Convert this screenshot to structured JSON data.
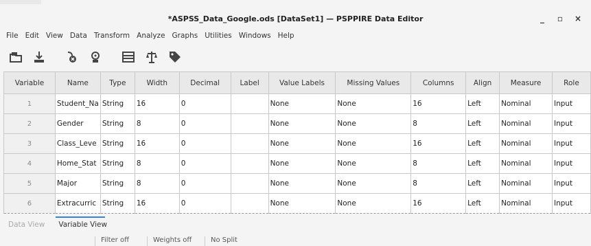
{
  "window": {
    "title": "*ASPSS_Data_Google.ods [DataSet1] — PSPPIRE Data Editor",
    "controls": [
      "_",
      "▫",
      "×"
    ]
  },
  "menu": [
    "File",
    "Edit",
    "View",
    "Data",
    "Transform",
    "Analyze",
    "Graphs",
    "Utilities",
    "Windows",
    "Help"
  ],
  "toolbar": [
    "open-icon",
    "save-icon",
    "goto-case-icon",
    "goto-variable-icon",
    "split-file-icon",
    "weight-cases-icon",
    "value-labels-icon"
  ],
  "grid": {
    "columns": [
      "Variable",
      "Name",
      "Type",
      "Width",
      "Decimal",
      "Label",
      "Value Labels",
      "Missing Values",
      "Columns",
      "Align",
      "Measure",
      "Role"
    ],
    "rows": [
      [
        "1",
        "Student_Na",
        "String",
        "16",
        "0",
        "",
        "None",
        "None",
        "16",
        "Left",
        "Nominal",
        "Input"
      ],
      [
        "2",
        "Gender",
        "String",
        "8",
        "0",
        "",
        "None",
        "None",
        "8",
        "Left",
        "Nominal",
        "Input"
      ],
      [
        "3",
        "Class_Leve",
        "String",
        "16",
        "0",
        "",
        "None",
        "None",
        "16",
        "Left",
        "Nominal",
        "Input"
      ],
      [
        "4",
        "Home_Stat",
        "String",
        "8",
        "0",
        "",
        "None",
        "None",
        "8",
        "Left",
        "Nominal",
        "Input"
      ],
      [
        "5",
        "Major",
        "String",
        "8",
        "0",
        "",
        "None",
        "None",
        "8",
        "Left",
        "Nominal",
        "Input"
      ],
      [
        "6",
        "Extracurric",
        "String",
        "16",
        "0",
        "",
        "None",
        "None",
        "16",
        "Left",
        "Nominal",
        "Input"
      ]
    ]
  },
  "tabs": [
    "Data View",
    "Variable View"
  ],
  "status": [
    "Filter off",
    "Weights off",
    "No Split"
  ]
}
